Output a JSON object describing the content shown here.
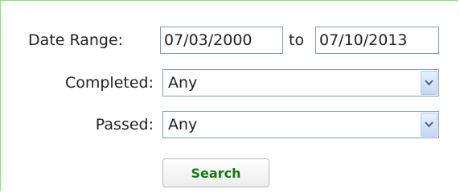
{
  "form": {
    "date_range_label": "Date Range:",
    "date_from": "07/03/2000",
    "to_label": "to",
    "date_to": "07/10/2013",
    "completed_label": "Completed:",
    "completed_value": "Any",
    "passed_label": "Passed:",
    "passed_value": "Any",
    "search_button_label": "Search"
  },
  "colors": {
    "panel_border": "#8be07a",
    "field_border": "#7f9db9",
    "button_text": "#127a12"
  },
  "icons": {
    "dropdown": "chevron-down-icon"
  }
}
